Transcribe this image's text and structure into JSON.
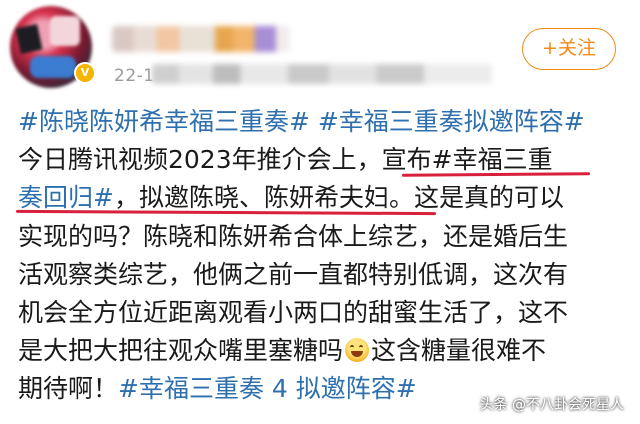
{
  "post": {
    "date_prefix": "22-1",
    "follow_label": "+关注",
    "lines": [
      [
        "#陈晓陈妍希幸福三重奏# #幸福三重奏拟邀阵容#"
      ],
      [
        "今日腾讯视频2023年推介会上，",
        "宣布#幸福三重"
      ],
      [
        "奏回归#",
        "，拟邀陈晓、陈妍希夫妇。",
        "这是真的可以"
      ],
      [
        "实现的吗？陈晓和陈妍希合体上综艺，还是婚后生"
      ],
      [
        "活观察类综艺，他俩之前一直都特别低调，这次有"
      ],
      [
        "机会全方位近距离观看小两口的甜蜜生活了，这不"
      ],
      [
        "是大把大把往观众嘴里塞糖吗",
        "这含糖量很难不"
      ],
      [
        "期待啊！",
        "#幸福三重奏 4 拟邀阵容#"
      ]
    ]
  },
  "watermark": "头条 @不八卦会死星人",
  "colors": {
    "accent": "#f08a1a",
    "tag": "#2e6fae",
    "underline": "#d8203b"
  },
  "icons": {
    "verified": "verified-badge-icon",
    "emoji": "grin-emoji-icon"
  }
}
